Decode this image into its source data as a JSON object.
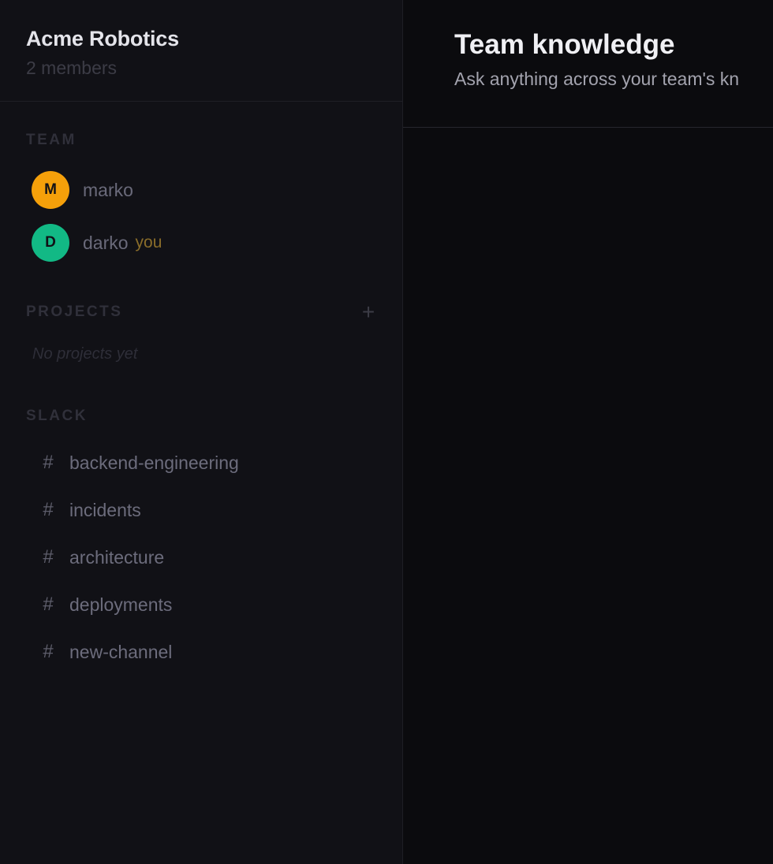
{
  "team": {
    "name": "Acme Robotics",
    "member_count": "2 members"
  },
  "sections": {
    "team_label": "TEAM",
    "projects_label": "PROJECTS",
    "slack_label": "SLACK"
  },
  "members": [
    {
      "initial": "M",
      "name": "marko",
      "color": "#f5a00a"
    },
    {
      "initial": "D",
      "name": "darko",
      "tag": "you",
      "color": "#12b985"
    }
  ],
  "projects": {
    "add_icon": "plus-icon",
    "empty_text": "No projects yet"
  },
  "channels": [
    {
      "icon": "hash-icon",
      "name": "backend-engineering"
    },
    {
      "icon": "hash-icon",
      "name": "incidents"
    },
    {
      "icon": "hash-icon",
      "name": "architecture"
    },
    {
      "icon": "hash-icon",
      "name": "deployments"
    },
    {
      "icon": "hash-icon",
      "name": "new-channel"
    }
  ],
  "main": {
    "title": "Team knowledge",
    "subtitle": "Ask anything across your team's kn"
  },
  "colors": {
    "sidebar_bg": "#111116",
    "main_bg": "#0b0b0e",
    "accent_you": "#8a6d2a"
  }
}
